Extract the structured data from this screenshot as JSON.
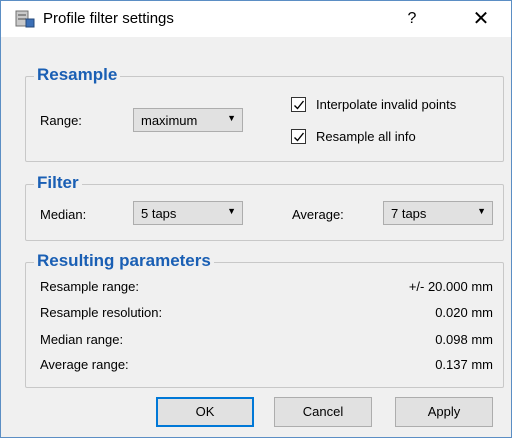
{
  "window": {
    "title": "Profile filter settings",
    "help_glyph": "?",
    "close_glyph": "✕"
  },
  "resample": {
    "title": "Resample",
    "range_label": "Range:",
    "range_value": "maximum",
    "interpolate_label": "Interpolate invalid points",
    "interpolate_checked": true,
    "resample_all_label": "Resample all info",
    "resample_all_checked": true
  },
  "filter": {
    "title": "Filter",
    "median_label": "Median:",
    "median_value": "5 taps",
    "average_label": "Average:",
    "average_value": "7 taps"
  },
  "results": {
    "title": "Resulting parameters",
    "rows": [
      {
        "label": "Resample range:",
        "value": "+/- 20.000 mm"
      },
      {
        "label": "Resample resolution:",
        "value": "0.020 mm"
      },
      {
        "label": "Median range:",
        "value": "0.098 mm"
      },
      {
        "label": "Average range:",
        "value": "0.137 mm"
      }
    ]
  },
  "buttons": {
    "ok": "OK",
    "cancel": "Cancel",
    "apply": "Apply"
  },
  "icons": {
    "app": "app-settings-icon",
    "dropdown": "chevron-down-icon",
    "check": "checkmark-icon"
  },
  "colors": {
    "group_title": "#1a5fb4",
    "default_button_border": "#0078d7",
    "window_border": "#5b8ec4"
  }
}
